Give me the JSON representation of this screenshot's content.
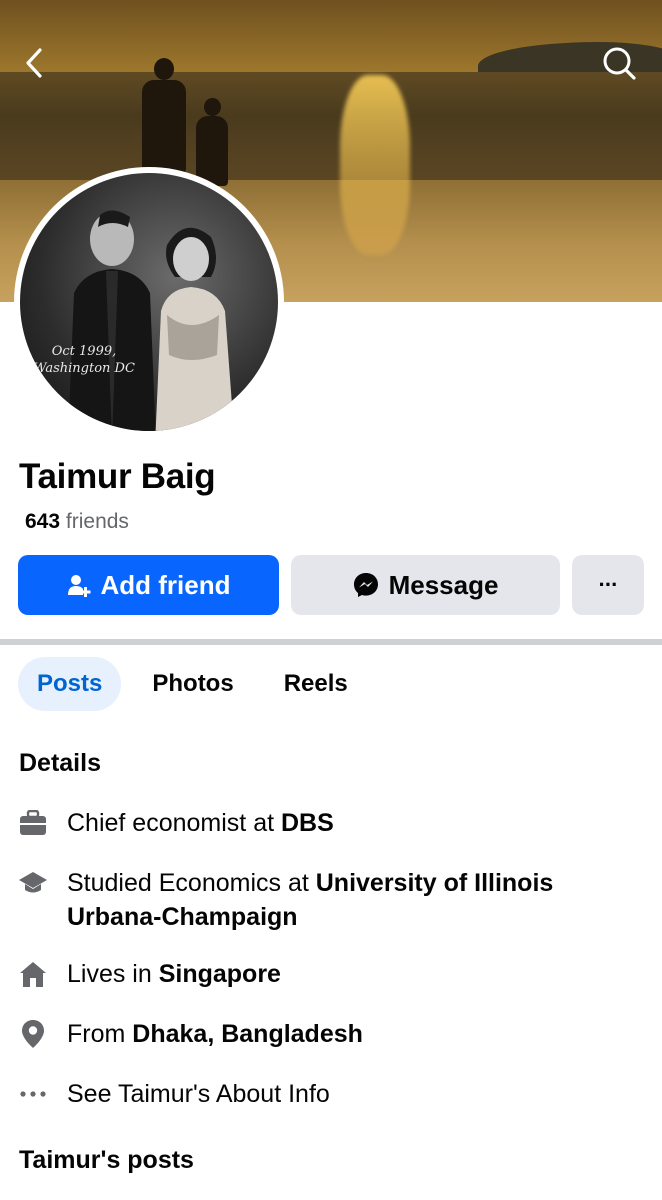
{
  "cover": {
    "photo_caption": ""
  },
  "avatar": {
    "caption_line1": "Oct 1999,",
    "caption_line2": "Washington DC"
  },
  "profile": {
    "name": "Taimur Baig",
    "friends_count": "643",
    "friends_label": "friends"
  },
  "actions": {
    "add_friend": "Add friend",
    "message": "Message",
    "more": "···"
  },
  "tabs": [
    {
      "label": "Posts",
      "active": true
    },
    {
      "label": "Photos",
      "active": false
    },
    {
      "label": "Reels",
      "active": false
    }
  ],
  "details": {
    "title": "Details",
    "work": {
      "prefix": "Chief economist at ",
      "value": "DBS"
    },
    "education": {
      "prefix": "Studied Economics at ",
      "value": "University of Illinois Urbana-Champaign"
    },
    "lives": {
      "prefix": "Lives in ",
      "value": "Singapore"
    },
    "from": {
      "prefix": "From ",
      "value": "Dhaka, Bangladesh"
    },
    "about": "See Taimur's About Info"
  },
  "posts_title": "Taimur's posts",
  "colors": {
    "accent": "#0866ff",
    "button_gray": "#e4e6eb",
    "tab_active_bg": "#e7f1fd",
    "tab_active_text": "#0064d1",
    "muted_text": "#65676b"
  }
}
